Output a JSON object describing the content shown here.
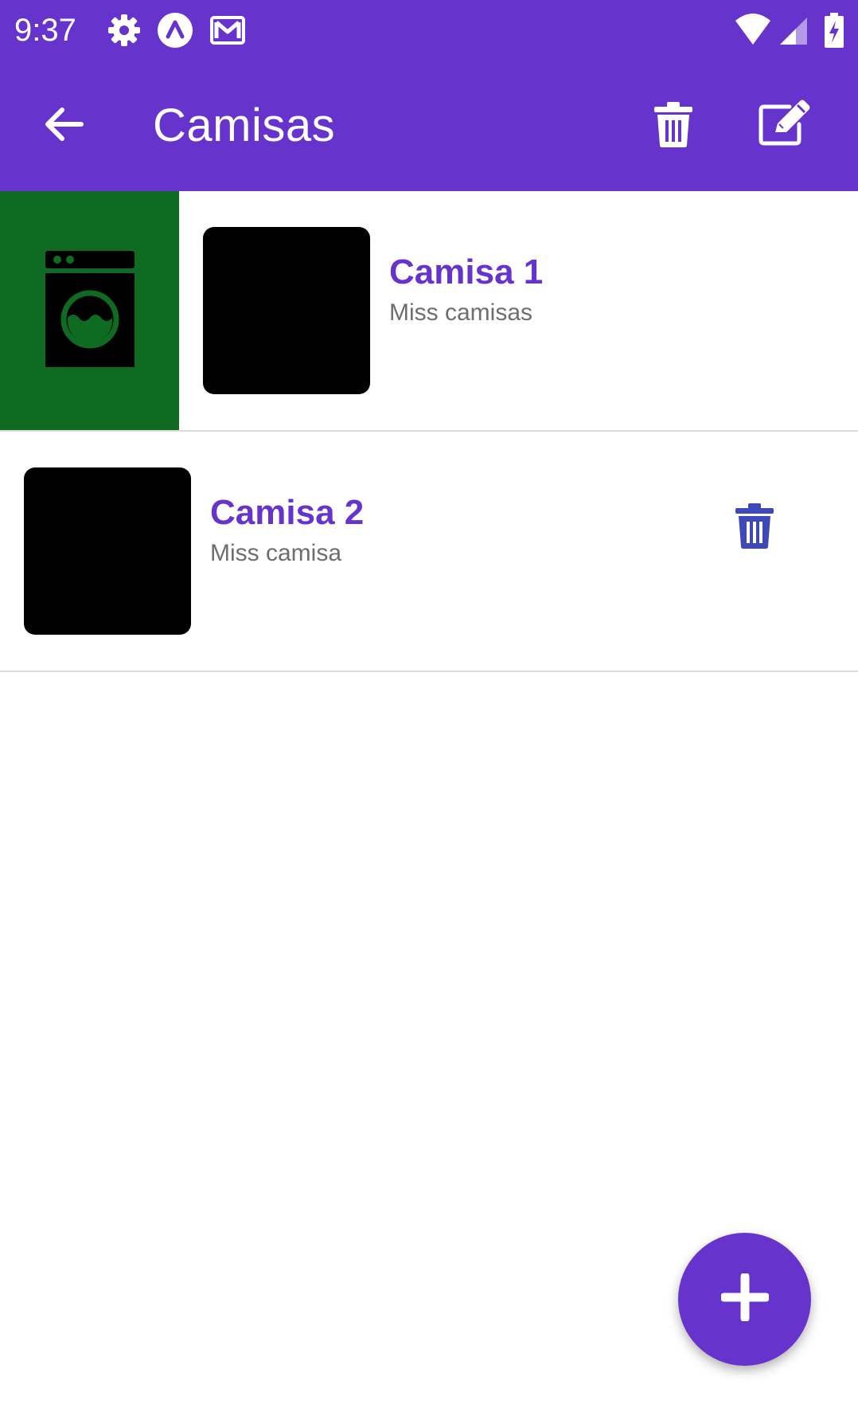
{
  "status_bar": {
    "time": "9:37",
    "icons": [
      "gear-icon",
      "expo-icon",
      "gmail-icon",
      "wifi-icon",
      "signal-icon",
      "battery-charging-icon"
    ]
  },
  "app_bar": {
    "title": "Camisas",
    "back_icon": "arrow-back-icon",
    "actions": [
      "trash-icon",
      "edit-icon"
    ]
  },
  "list": {
    "items": [
      {
        "title": "Camisa 1",
        "subtitle": "Miss camisas",
        "swipe_action_icon": "washing-machine-icon"
      },
      {
        "title": "Camisa 2",
        "subtitle": "Miss camisa",
        "action_icon": "trash-icon"
      }
    ]
  },
  "fab": {
    "icon": "plus-icon"
  },
  "colors": {
    "primary": "#6633cc",
    "swipe_action_bg": "#0f6b22",
    "swipe_icon": "#0f6b22",
    "row_delete_icon": "#3f48b8",
    "subtitle": "#6e6e6e",
    "divider": "#dcdcdc"
  }
}
